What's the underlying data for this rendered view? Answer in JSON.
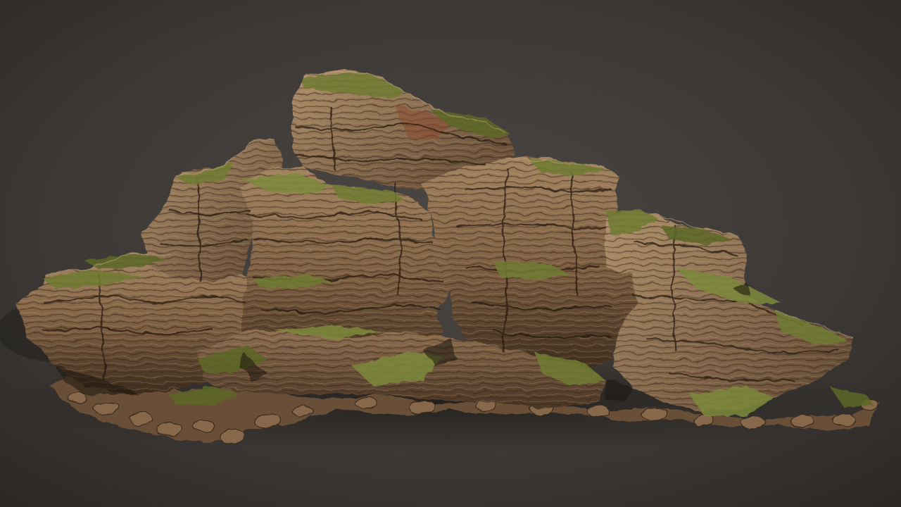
{
  "scene": {
    "subject": "layered-sandstone-rock-formation-with-moss",
    "colors": {
      "background_center": "#4a4642",
      "background_edge": "#2b2826",
      "rock_light": "#a98a66",
      "rock_mid": "#7a5d41",
      "rock_dark": "#3c2c1f",
      "rock_shadow": "#22190f",
      "moss_light": "#7c8a3a",
      "moss_dark": "#4e5a22",
      "rust": "#8b4a2f",
      "ground_shadow": "#1c1a18"
    }
  }
}
